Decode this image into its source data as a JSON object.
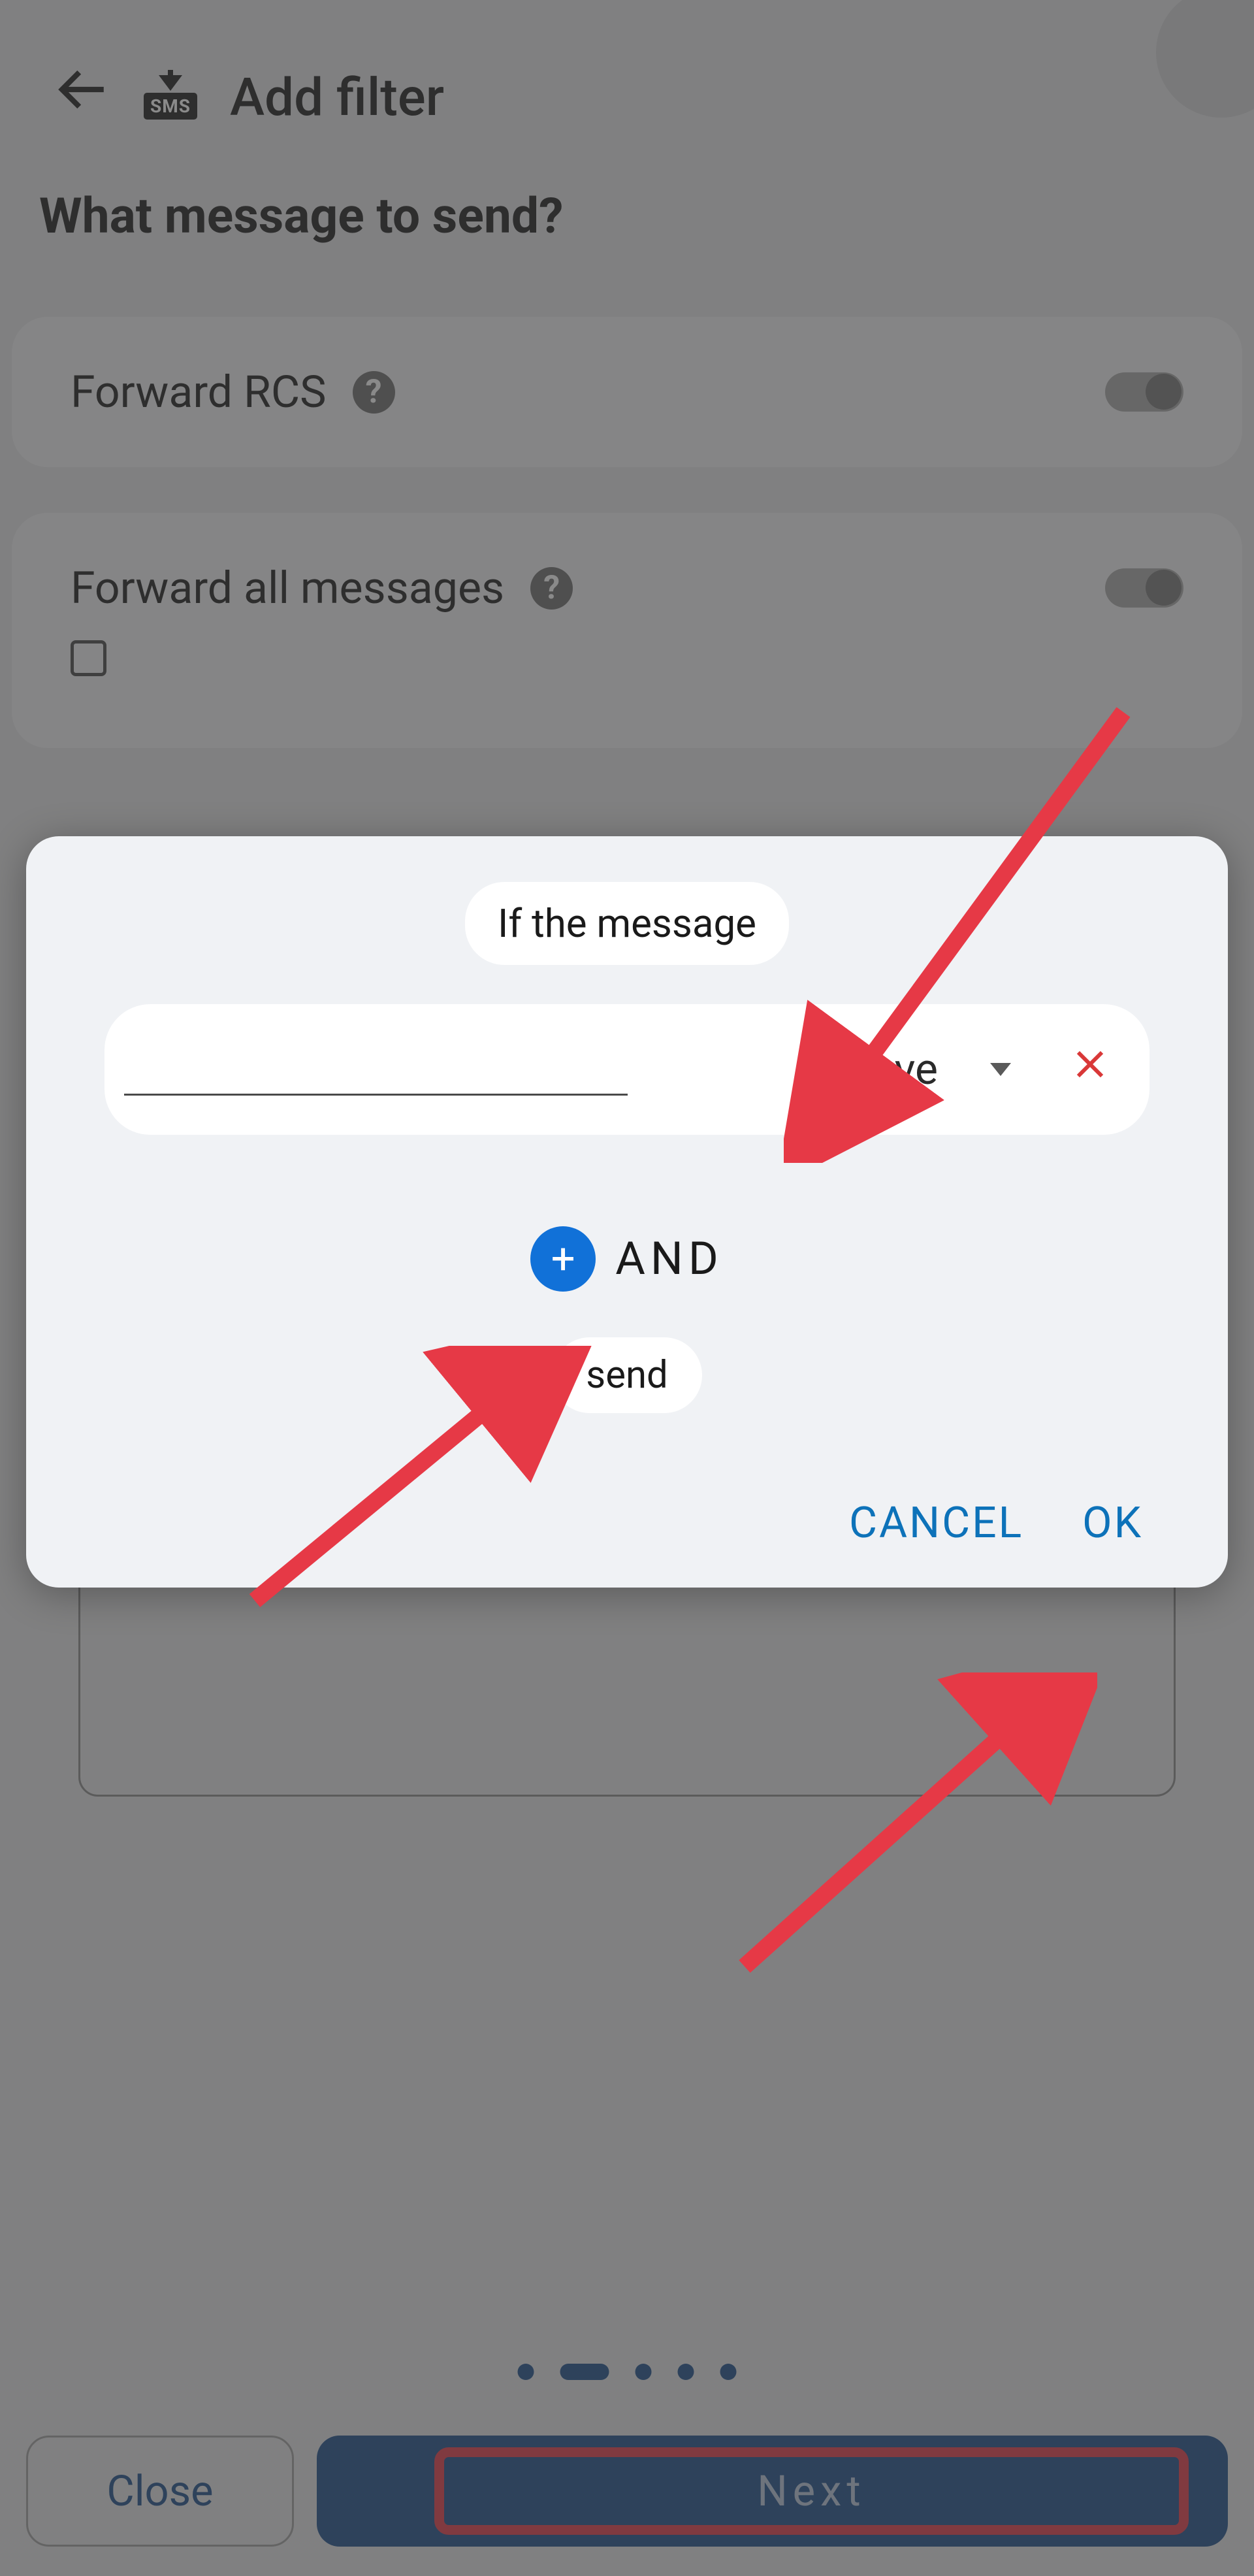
{
  "header": {
    "title": "Add filter",
    "sms_badge": "SMS"
  },
  "section": {
    "title": "What message to send?"
  },
  "cards": {
    "forward_rcs": {
      "label": "Forward RCS",
      "enabled": false
    },
    "forward_all": {
      "label": "Forward all messages",
      "enabled": false
    }
  },
  "modal": {
    "title": "If the message",
    "condition": {
      "input_value": "",
      "operator": "have"
    },
    "and_label": "AND",
    "send_label": "send",
    "cancel": "CANCEL",
    "ok": "OK"
  },
  "nav": {
    "close": "Close",
    "next": "Next"
  },
  "pagination": {
    "total": 5,
    "active_index": 1
  },
  "annotations": {
    "arrow_color": "#e63946"
  }
}
